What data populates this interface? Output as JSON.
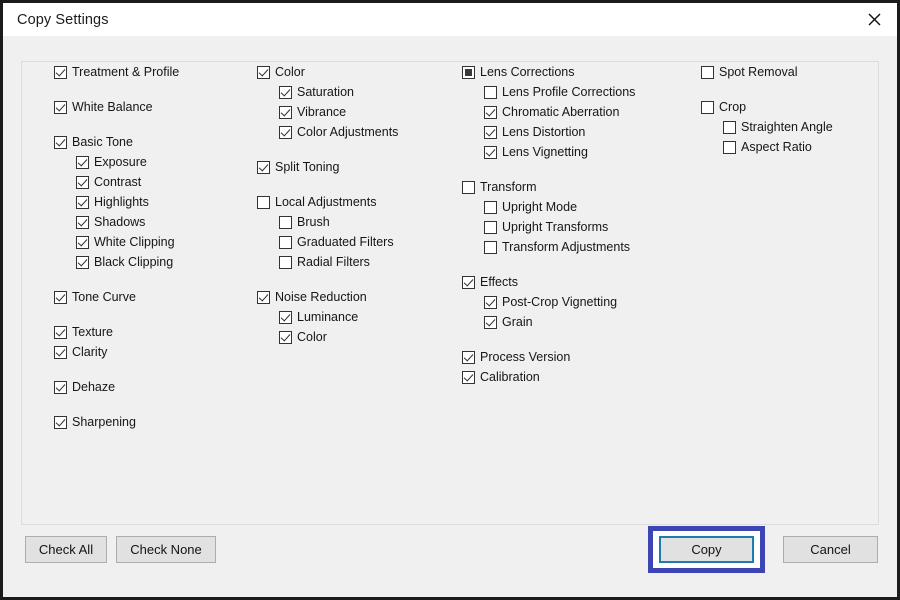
{
  "window": {
    "title": "Copy Settings",
    "close_icon": "close-icon"
  },
  "columns": [
    {
      "id": "col-1",
      "items": [
        {
          "label": "Treatment & Profile",
          "state": "checked",
          "indent": 0,
          "gap": false
        },
        {
          "label": "White Balance",
          "state": "checked",
          "indent": 0,
          "gap": true
        },
        {
          "label": "Basic Tone",
          "state": "checked",
          "indent": 0,
          "gap": true
        },
        {
          "label": "Exposure",
          "state": "checked",
          "indent": 1,
          "gap": false
        },
        {
          "label": "Contrast",
          "state": "checked",
          "indent": 1,
          "gap": false
        },
        {
          "label": "Highlights",
          "state": "checked",
          "indent": 1,
          "gap": false
        },
        {
          "label": "Shadows",
          "state": "checked",
          "indent": 1,
          "gap": false
        },
        {
          "label": "White Clipping",
          "state": "checked",
          "indent": 1,
          "gap": false
        },
        {
          "label": "Black Clipping",
          "state": "checked",
          "indent": 1,
          "gap": false
        },
        {
          "label": "Tone Curve",
          "state": "checked",
          "indent": 0,
          "gap": true
        },
        {
          "label": "Texture",
          "state": "checked",
          "indent": 0,
          "gap": true
        },
        {
          "label": "Clarity",
          "state": "checked",
          "indent": 0,
          "gap": false
        },
        {
          "label": "Dehaze",
          "state": "checked",
          "indent": 0,
          "gap": true
        },
        {
          "label": "Sharpening",
          "state": "checked",
          "indent": 0,
          "gap": true
        }
      ]
    },
    {
      "id": "col-2",
      "items": [
        {
          "label": "Color",
          "state": "checked",
          "indent": 0,
          "gap": false
        },
        {
          "label": "Saturation",
          "state": "checked",
          "indent": 1,
          "gap": false
        },
        {
          "label": "Vibrance",
          "state": "checked",
          "indent": 1,
          "gap": false
        },
        {
          "label": "Color Adjustments",
          "state": "checked",
          "indent": 1,
          "gap": false
        },
        {
          "label": "Split Toning",
          "state": "checked",
          "indent": 0,
          "gap": true
        },
        {
          "label": "Local Adjustments",
          "state": "unchecked",
          "indent": 0,
          "gap": true
        },
        {
          "label": "Brush",
          "state": "unchecked",
          "indent": 1,
          "gap": false
        },
        {
          "label": "Graduated Filters",
          "state": "unchecked",
          "indent": 1,
          "gap": false
        },
        {
          "label": "Radial Filters",
          "state": "unchecked",
          "indent": 1,
          "gap": false
        },
        {
          "label": "Noise Reduction",
          "state": "checked",
          "indent": 0,
          "gap": true
        },
        {
          "label": "Luminance",
          "state": "checked",
          "indent": 1,
          "gap": false
        },
        {
          "label": "Color",
          "state": "checked",
          "indent": 1,
          "gap": false
        }
      ]
    },
    {
      "id": "col-3",
      "items": [
        {
          "label": "Lens Corrections",
          "state": "mixed",
          "indent": 0,
          "gap": false
        },
        {
          "label": "Lens Profile Corrections",
          "state": "unchecked",
          "indent": 1,
          "gap": false
        },
        {
          "label": "Chromatic Aberration",
          "state": "checked",
          "indent": 1,
          "gap": false
        },
        {
          "label": "Lens Distortion",
          "state": "checked",
          "indent": 1,
          "gap": false
        },
        {
          "label": "Lens Vignetting",
          "state": "checked",
          "indent": 1,
          "gap": false
        },
        {
          "label": "Transform",
          "state": "unchecked",
          "indent": 0,
          "gap": true
        },
        {
          "label": "Upright Mode",
          "state": "unchecked",
          "indent": 1,
          "gap": false
        },
        {
          "label": "Upright Transforms",
          "state": "unchecked",
          "indent": 1,
          "gap": false
        },
        {
          "label": "Transform Adjustments",
          "state": "unchecked",
          "indent": 1,
          "gap": false
        },
        {
          "label": "Effects",
          "state": "checked",
          "indent": 0,
          "gap": true
        },
        {
          "label": "Post-Crop Vignetting",
          "state": "checked",
          "indent": 1,
          "gap": false
        },
        {
          "label": "Grain",
          "state": "checked",
          "indent": 1,
          "gap": false
        },
        {
          "label": "Process Version",
          "state": "checked",
          "indent": 0,
          "gap": true
        },
        {
          "label": "Calibration",
          "state": "checked",
          "indent": 0,
          "gap": false
        }
      ]
    },
    {
      "id": "col-4",
      "items": [
        {
          "label": "Spot Removal",
          "state": "unchecked",
          "indent": 0,
          "gap": false
        },
        {
          "label": "Crop",
          "state": "unchecked",
          "indent": 0,
          "gap": true
        },
        {
          "label": "Straighten Angle",
          "state": "unchecked",
          "indent": 1,
          "gap": false
        },
        {
          "label": "Aspect Ratio",
          "state": "unchecked",
          "indent": 1,
          "gap": false
        }
      ]
    }
  ],
  "footer": {
    "check_all": "Check All",
    "check_none": "Check None",
    "copy": "Copy",
    "cancel": "Cancel"
  },
  "colors": {
    "focus_ring": "#3d45b5",
    "default_button_border": "#1d7cad",
    "window_border": "#1b1b1b",
    "panel_background": "#f0f0f0"
  }
}
